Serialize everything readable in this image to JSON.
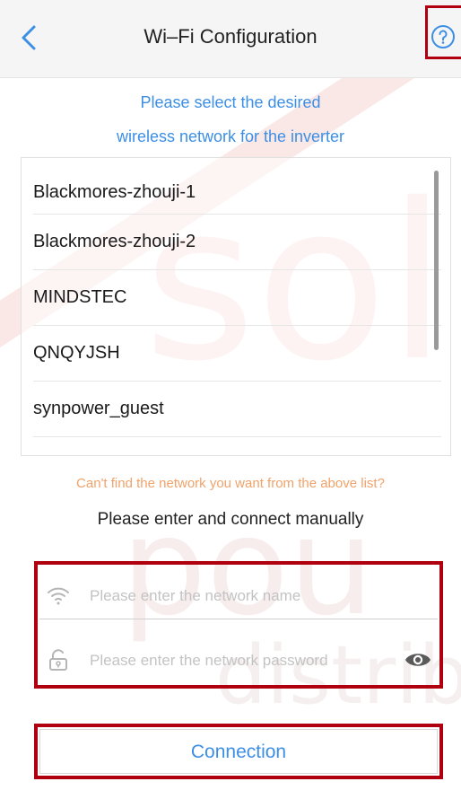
{
  "header": {
    "title": "Wi–Fi Configuration",
    "back_icon": "chevron-left-icon",
    "help_icon": "question-circle-icon"
  },
  "instructions": {
    "line1": "Please select the desired",
    "line2": "wireless network for the inverter"
  },
  "networks": [
    {
      "name": "Blackmores-zhouji-1"
    },
    {
      "name": "Blackmores-zhouji-2"
    },
    {
      "name": "MINDSTEC"
    },
    {
      "name": "QNQYJSH"
    },
    {
      "name": "synpower_guest"
    }
  ],
  "manual": {
    "hint": "Can't find the network you want from the above list?",
    "title": "Please enter and connect manually"
  },
  "form": {
    "ssid_placeholder": "Please enter the network name",
    "password_placeholder": "Please enter the network password",
    "ssid_icon": "wifi-icon",
    "password_icon": "lock-icon",
    "eye_icon": "eye-icon"
  },
  "connect_button": {
    "label": "Connection"
  },
  "colors": {
    "accent": "#3d8fe6",
    "hint": "#f0a26a",
    "highlight": "#b00010"
  }
}
